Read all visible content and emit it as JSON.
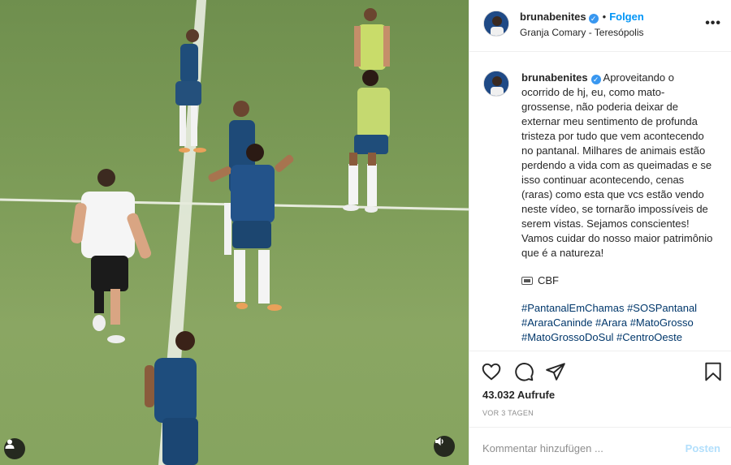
{
  "post": {
    "username": "brunabenites",
    "follow_label": "Folgen",
    "separator": "•",
    "location": "Granja Comary - Teresópolis",
    "more_label": "•••",
    "caption": "Aproveitando o ocorrido de hj, eu, como mato-grossense, não poderia deixar de externar meu sentimento de profunda tristeza por tudo que vem acontecendo no pantanal. Milhares de animais estão perdendo a vida com as queimadas e se isso continuar acontecendo, cenas (raras) como esta que vcs estão vendo neste vídeo, se tornarão impossíveis de serem vistas. Sejamos conscientes! Vamos cuidar do nosso maior patrimônio que é a natureza!",
    "credit": "CBF",
    "hashtags": "#PantanalEmChamas #SOSPantanal #AraraCaninde #Arara #MatoGrosso #MatoGrossoDoSul #CentroOeste",
    "views": "43.032 Aufrufe",
    "timestamp": "VOR 3 TAGEN",
    "comment_placeholder": "Kommentar hinzufügen ...",
    "post_label": "Posten"
  },
  "icons": {
    "verified": "verified-badge-icon",
    "like": "heart-icon",
    "comment": "comment-icon",
    "share": "send-icon",
    "save": "bookmark-icon",
    "tag": "user-tag-icon",
    "mute": "speaker-icon",
    "credit": "camera-icon"
  },
  "colors": {
    "accent": "#0095f6",
    "hashtag": "#00376b",
    "post_disabled": "#b2dffc",
    "pitch": "#7d9c58"
  }
}
